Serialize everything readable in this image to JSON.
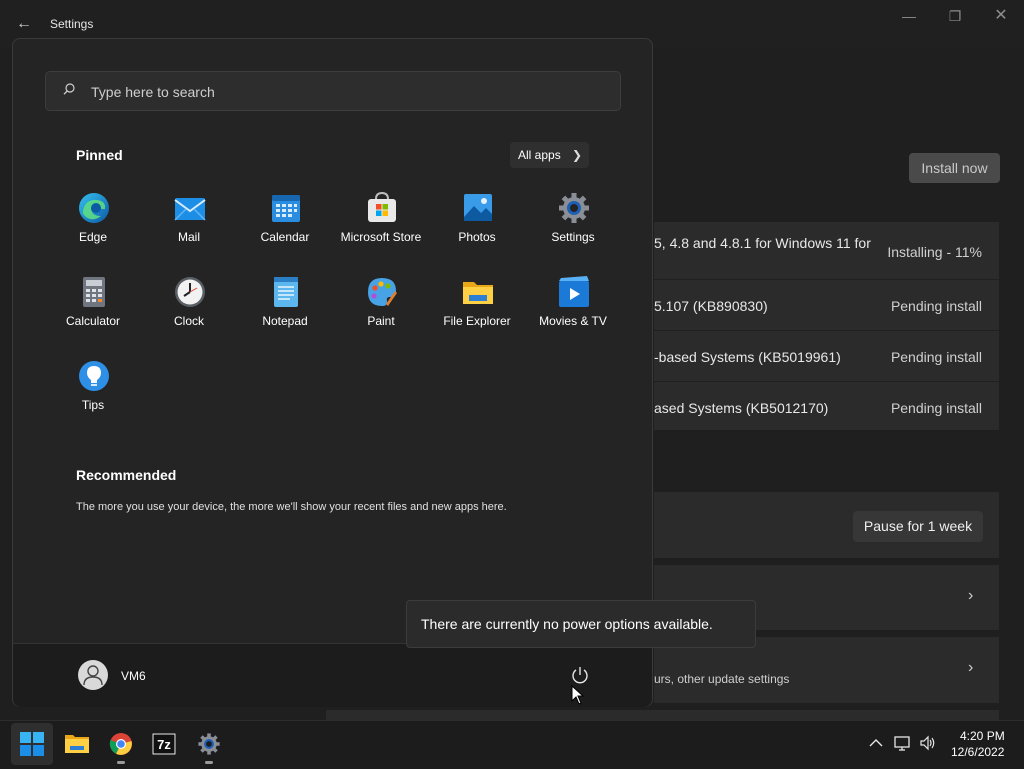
{
  "window": {
    "title": "Settings",
    "install_now": "Install now",
    "updates": [
      {
        "name": "5, 4.8 and 4.8.1 for Windows 11 for",
        "status": "Installing - 11%"
      },
      {
        "name": "5.107 (KB890830)",
        "status": "Pending install"
      },
      {
        "name": "-based Systems (KB5019961)",
        "status": "Pending install"
      },
      {
        "name": "ased Systems (KB5012170)",
        "status": "Pending install"
      }
    ],
    "pause_button": "Pause for 1 week",
    "advanced_subtext": "urs, other update settings"
  },
  "start": {
    "search_placeholder": "Type here to search",
    "pinned_title": "Pinned",
    "all_apps": "All apps",
    "apps": [
      {
        "name": "Edge",
        "icon": "edge-icon"
      },
      {
        "name": "Mail",
        "icon": "mail-icon"
      },
      {
        "name": "Calendar",
        "icon": "calendar-icon"
      },
      {
        "name": "Microsoft Store",
        "icon": "store-icon"
      },
      {
        "name": "Photos",
        "icon": "photos-icon"
      },
      {
        "name": "Settings",
        "icon": "gear-icon"
      },
      {
        "name": "Calculator",
        "icon": "calculator-icon"
      },
      {
        "name": "Clock",
        "icon": "clock-icon"
      },
      {
        "name": "Notepad",
        "icon": "notepad-icon"
      },
      {
        "name": "Paint",
        "icon": "paint-icon"
      },
      {
        "name": "File Explorer",
        "icon": "folder-icon"
      },
      {
        "name": "Movies & TV",
        "icon": "movies-icon"
      },
      {
        "name": "Tips",
        "icon": "tips-icon"
      }
    ],
    "recommended_title": "Recommended",
    "recommended_text": "The more you use your device, the more we'll show your recent files and new apps here.",
    "user_name": "VM6",
    "power_tooltip": "There are currently no power options available."
  },
  "taskbar": {
    "time": "4:20 PM",
    "date": "12/6/2022"
  },
  "colors": {
    "accent": "#0078d4",
    "background": "#1f1f1f",
    "panel": "#2b2b2b"
  }
}
